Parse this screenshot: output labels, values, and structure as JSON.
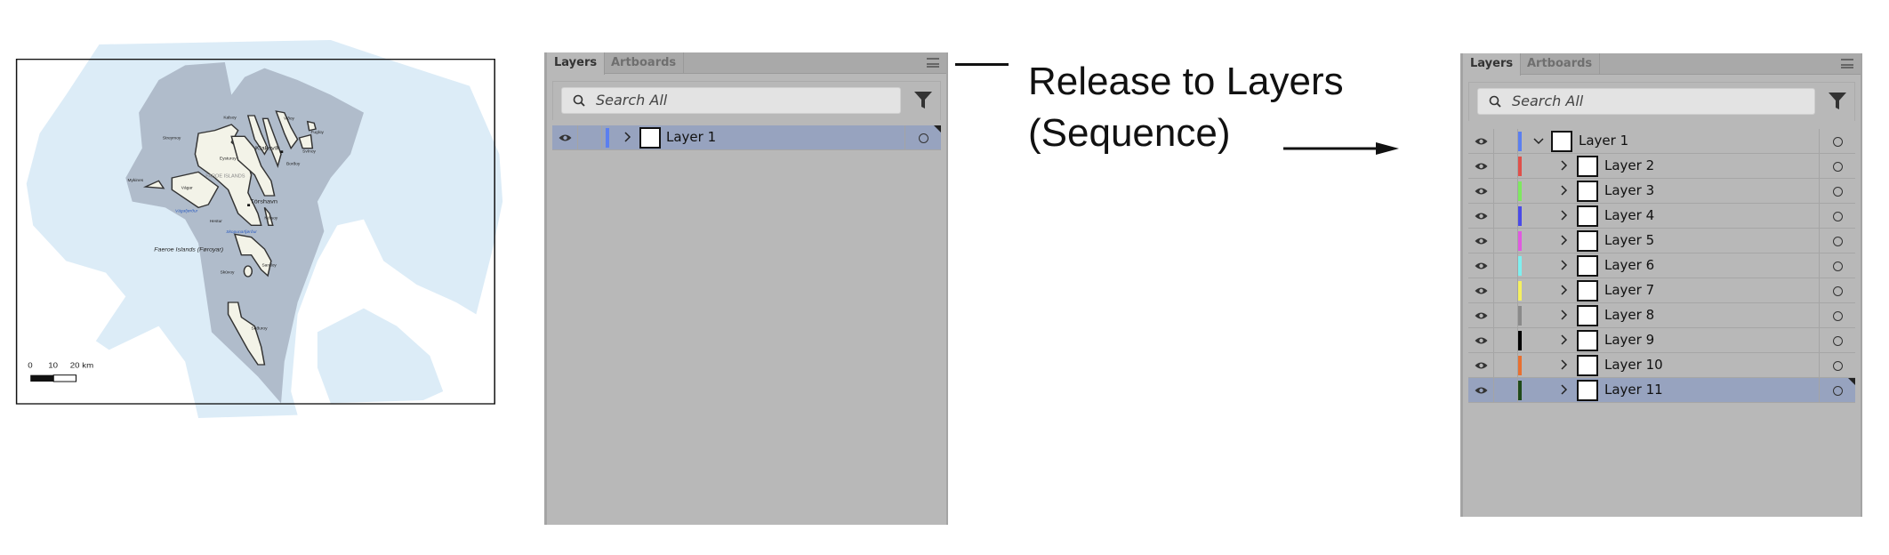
{
  "map": {
    "labels": {
      "kalsoy": "Kalsoy",
      "vidoy": "Viðoy",
      "fugloy": "Fugloy",
      "streymoy": "Streymoy",
      "klaksvik": "Klaksvík",
      "svinoy": "Svínoy",
      "bordoy": "Borðoy",
      "eysturoy": "Eysturoy",
      "country": "FAROE ISLANDS",
      "mykines": "Mykines",
      "vagar": "Vágar",
      "vagafjordur": "Vágafjørður",
      "torshavn": "Tórshavn",
      "hestur": "Hestur",
      "nolsoy": "Nólsoy",
      "skopunarfjordur": "Skopunarfjørður",
      "title": "Faeroe Islands (Føroyar)",
      "sandoy": "Sandoy",
      "skuvoy": "Skúvoy",
      "suduroy": "Suðuroy"
    },
    "scale": {
      "t0": "0",
      "t10": "10",
      "t20": "20 km"
    },
    "colors": {
      "sea": "#dcecf7",
      "shelf": "#b0bccb",
      "land": "#f3f3e8",
      "water_label": "#2a5bc0"
    }
  },
  "annotation": {
    "line1": "Release to Layers",
    "line2": "(Sequence)"
  },
  "panel_before": {
    "tabs": [
      "Layers",
      "Artboards"
    ],
    "search_placeholder": "Search All",
    "layers": [
      {
        "name": "Layer 1",
        "color": "#5b7ff0",
        "expanded": false,
        "selected": true
      }
    ]
  },
  "panel_after": {
    "tabs": [
      "Layers",
      "Artboards"
    ],
    "search_placeholder": "Search All",
    "layers": [
      {
        "name": "Layer 1",
        "color": "#5b7ff0",
        "expanded": true,
        "level": 0
      },
      {
        "name": "Layer 2",
        "color": "#e0504a",
        "level": 1
      },
      {
        "name": "Layer 3",
        "color": "#7ee860",
        "level": 1
      },
      {
        "name": "Layer 4",
        "color": "#4a4ae8",
        "level": 1
      },
      {
        "name": "Layer 5",
        "color": "#e05ae0",
        "level": 1
      },
      {
        "name": "Layer 6",
        "color": "#7ef0f0",
        "level": 1
      },
      {
        "name": "Layer 7",
        "color": "#f5f060",
        "level": 1
      },
      {
        "name": "Layer 8",
        "color": "#8a8a8a",
        "level": 1
      },
      {
        "name": "Layer 9",
        "color": "#000000",
        "level": 1
      },
      {
        "name": "Layer 10",
        "color": "#e87030",
        "level": 1
      },
      {
        "name": "Layer 11",
        "color": "#1f4a1a",
        "level": 1,
        "selected": true
      }
    ]
  }
}
